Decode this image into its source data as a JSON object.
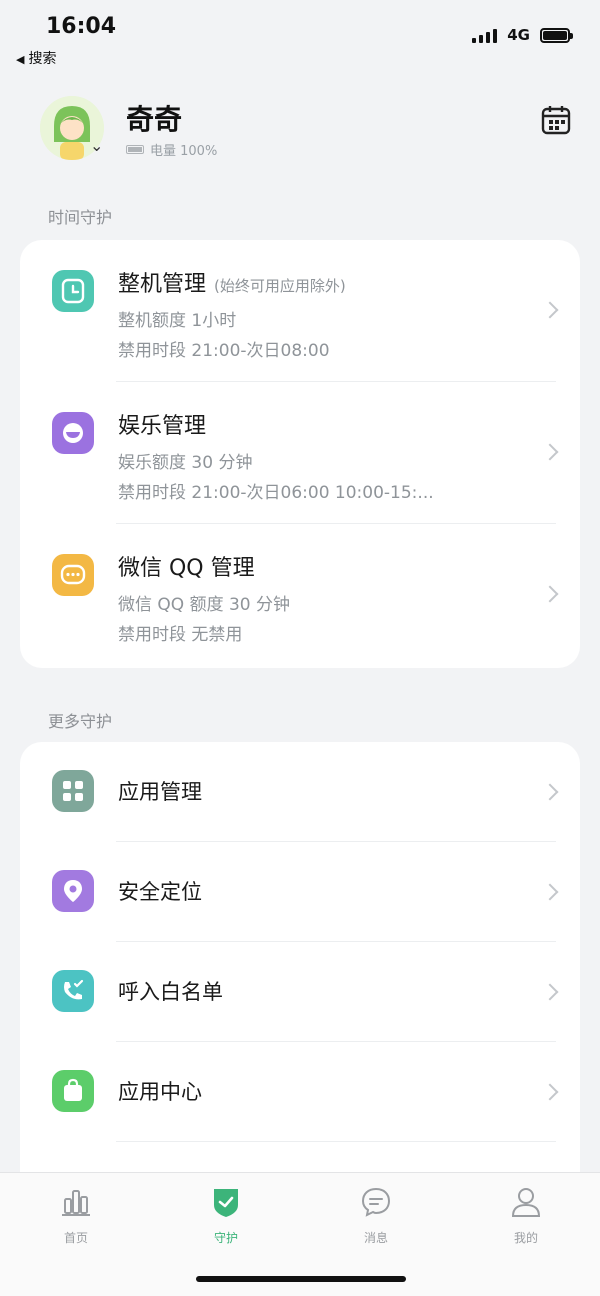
{
  "status": {
    "time": "16:04",
    "back_label": "搜索",
    "network": "4G"
  },
  "profile": {
    "name": "奇奇",
    "battery_text": "电量 100%"
  },
  "section_time": {
    "title": "时间守护"
  },
  "time_items": [
    {
      "title": "整机管理",
      "note": "(始终可用应用除外)",
      "line1": "整机额度 1小时",
      "line2": "禁用时段 21:00-次日08:00",
      "icon": "clock-icon",
      "color": "#4fc7b2"
    },
    {
      "title": "娱乐管理",
      "note": "",
      "line1": "娱乐额度 30 分钟",
      "line2": "禁用时段 21:00-次日06:00 10:00-15:...",
      "icon": "smile-icon",
      "color": "#9b72e0"
    },
    {
      "title": "微信 QQ 管理",
      "note": "",
      "line1": "微信 QQ 额度 30 分钟",
      "line2": "禁用时段 无禁用",
      "icon": "chat-icon",
      "color": "#f3b844"
    }
  ],
  "section_more": {
    "title": "更多守护"
  },
  "more_items": [
    {
      "title": "应用管理",
      "icon": "apps-grid-icon",
      "color": "#7fa79a"
    },
    {
      "title": "安全定位",
      "icon": "location-pin-icon",
      "color": "#a27ae0"
    },
    {
      "title": "呼入白名单",
      "icon": "phone-check-icon",
      "color": "#4cc3c3"
    },
    {
      "title": "应用中心",
      "icon": "shopping-bag-icon",
      "color": "#5ccd6a"
    }
  ],
  "tabs": [
    {
      "label": "首页",
      "icon": "bar-chart-icon"
    },
    {
      "label": "守护",
      "icon": "shield-check-icon"
    },
    {
      "label": "消息",
      "icon": "message-icon"
    },
    {
      "label": "我的",
      "icon": "person-icon"
    }
  ],
  "colors": {
    "accent": "#3cb47a",
    "background": "#f2f3f5"
  }
}
